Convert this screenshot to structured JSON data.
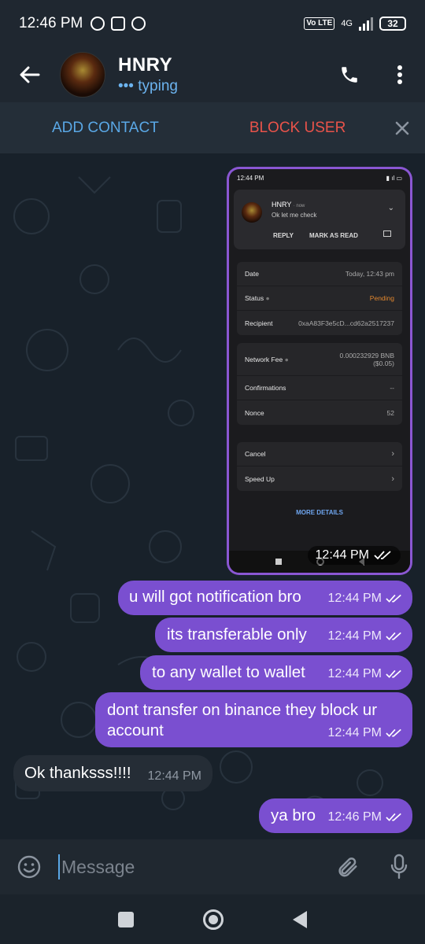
{
  "status_bar": {
    "time": "12:46 PM",
    "network": "4G",
    "lte": "Vo LTE",
    "battery": "32"
  },
  "header": {
    "name": "HNRY",
    "status": "typing"
  },
  "action_bar": {
    "add_contact": "ADD CONTACT",
    "block_user": "BLOCK USER"
  },
  "screenshot": {
    "time": "12:44 PM",
    "notification": {
      "title": "HNRY",
      "when": "now",
      "message": "Ok let me check",
      "reply": "REPLY",
      "mark_as_read": "MARK AS READ"
    },
    "details": [
      {
        "label": "Date",
        "value": "Today, 12:43 pm"
      },
      {
        "label": "Status",
        "value": "Pending"
      },
      {
        "label": "Recipient",
        "value": "0xaA83F3e5cD...cd62a2517237"
      }
    ],
    "fees": [
      {
        "label": "Network Fee",
        "value": "0.000232929 BNB",
        "value2": "($0.05)"
      },
      {
        "label": "Confirmations",
        "value": "--"
      },
      {
        "label": "Nonce",
        "value": "52"
      }
    ],
    "actions": [
      {
        "label": "Cancel"
      },
      {
        "label": "Speed Up"
      }
    ],
    "more_details": "MORE DETAILS",
    "bubble_time": "12:44 PM"
  },
  "messages": [
    {
      "text": "u will got notification bro",
      "time": "12:44 PM"
    },
    {
      "text": "its transferable only",
      "time": "12:44 PM"
    },
    {
      "text": "to any wallet to wallet",
      "time": "12:44 PM"
    },
    {
      "text": "dont transfer on binance they block ur account",
      "time": "12:44 PM"
    },
    {
      "text": "Ok thanksss!!!!",
      "time": "12:44 PM"
    },
    {
      "text": "ya bro",
      "time": "12:46 PM"
    }
  ],
  "composer": {
    "placeholder": "Message"
  },
  "colors": {
    "outgoing_bubble": "#7a4fd0",
    "incoming_bubble": "#252d36",
    "accent": "#5aa8e6",
    "block_red": "#e9534a"
  }
}
